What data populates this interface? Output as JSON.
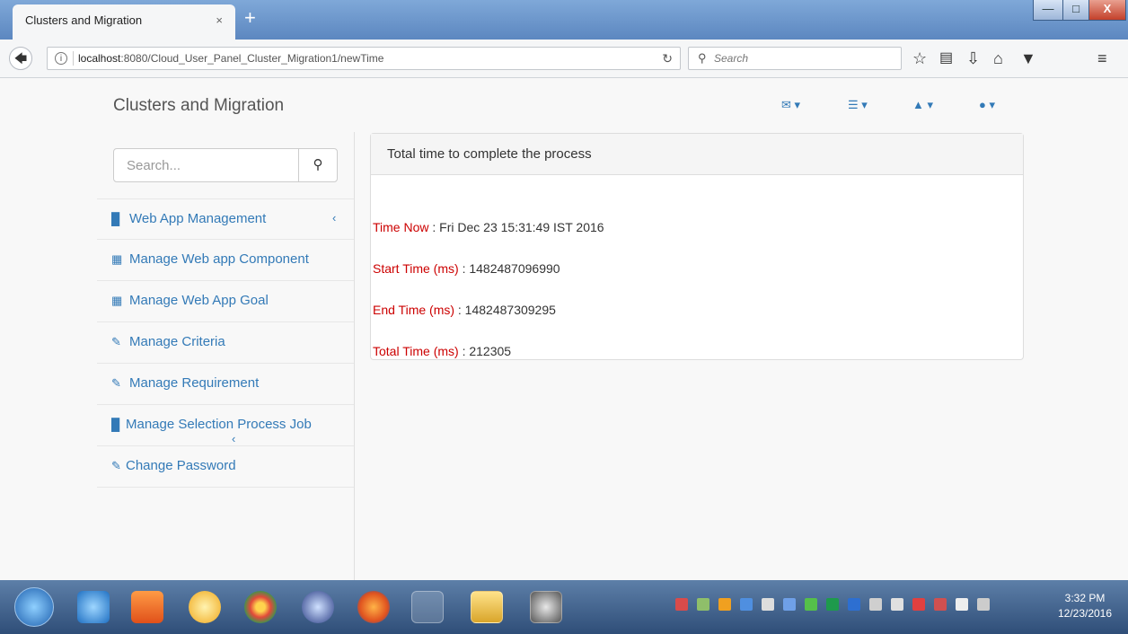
{
  "browser": {
    "tab_title": "Clusters and Migration",
    "tab_close": "×",
    "new_tab": "+",
    "url_host": "localhost",
    "url_rest": ":8080/Cloud_User_Panel_Cluster_Migration1/newTime",
    "search_placeholder": "Search"
  },
  "app": {
    "brand": "Clusters and Migration",
    "sidebar_search_placeholder": "Search...",
    "menu": [
      {
        "label": "Web App Management"
      },
      {
        "label": "Manage Web app Component"
      },
      {
        "label": "Manage Web App Goal"
      },
      {
        "label": "Manage Criteria"
      },
      {
        "label": "Manage Requirement"
      },
      {
        "label": "Manage Selection Process Job"
      },
      {
        "label": "Change Password"
      }
    ],
    "panel": {
      "heading": "Total time to complete the process",
      "rows": [
        {
          "key": "Time Now",
          "value": ": Fri Dec 23 15:31:49 IST 2016"
        },
        {
          "key": "Start Time (ms)",
          "value": ": 1482487096990"
        },
        {
          "key": "End Time (ms)",
          "value": ": 1482487309295"
        },
        {
          "key": "Total Time (ms)",
          "value": ": 212305"
        }
      ]
    }
  },
  "taskbar": {
    "time": "3:32 PM",
    "date": "12/23/2016"
  },
  "colors": {
    "link": "#337ab7",
    "label_red": "#cc0000"
  }
}
